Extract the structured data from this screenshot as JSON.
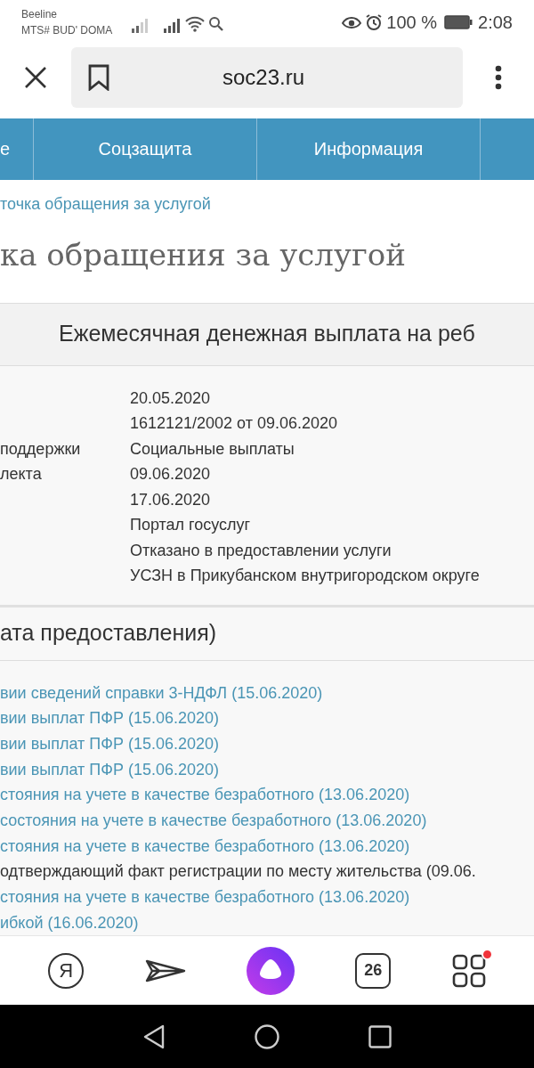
{
  "status_bar": {
    "carrier_1": "Beeline",
    "carrier_2": "MTS# BUD' DOMA",
    "battery_text": "100 %",
    "time": "2:08"
  },
  "address_bar": {
    "url": "soc23.ru"
  },
  "nav_menu": [
    {
      "label": "е"
    },
    {
      "label": "Соцзащита"
    },
    {
      "label": "Информация"
    }
  ],
  "breadcrumb": "точка обращения за услугой",
  "page_title": "ка обращения за услугой",
  "card": {
    "title": "Ежемесячная денежная выплата на реб",
    "rows": [
      {
        "label": "",
        "value": "20.05.2020"
      },
      {
        "label": "",
        "value": "1612121/2002 от 09.06.2020"
      },
      {
        "label": "поддержки",
        "value": "Социальные выплаты"
      },
      {
        "label": "лекта",
        "value": "09.06.2020"
      },
      {
        "label": "",
        "value": "17.06.2020"
      },
      {
        "label": "",
        "value": "Портал госуслуг"
      },
      {
        "label": "",
        "value": "Отказано в предоставлении услуги"
      },
      {
        "label": "",
        "value": "УСЗН в Прикубанском внутригородском округе"
      }
    ]
  },
  "section": {
    "title": "ата предоставления)",
    "items": [
      {
        "text": "вии сведений справки 3-НДФЛ (15.06.2020)",
        "link": true
      },
      {
        "text": "вии выплат ПФР (15.06.2020)",
        "link": true
      },
      {
        "text": "вии выплат ПФР (15.06.2020)",
        "link": true
      },
      {
        "text": "вии выплат ПФР (15.06.2020)",
        "link": true
      },
      {
        "text": "стояния на учете в качестве безработного (13.06.2020)",
        "link": true
      },
      {
        "text": "состояния на учете в качестве безработного (13.06.2020)",
        "link": true
      },
      {
        "text": "стояния на учете в качестве безработного (13.06.2020)",
        "link": true
      },
      {
        "text": "одтверждающий факт регистрации по месту жительства (09.06.",
        "link": false
      },
      {
        "text": "стояния на учете в качестве безработного (13.06.2020)",
        "link": true
      },
      {
        "text": "ибкой (16.06.2020)",
        "link": true
      }
    ]
  },
  "toolbar": {
    "logo_letter": "Я",
    "tabs_count": "26",
    "apps_notification": true
  }
}
